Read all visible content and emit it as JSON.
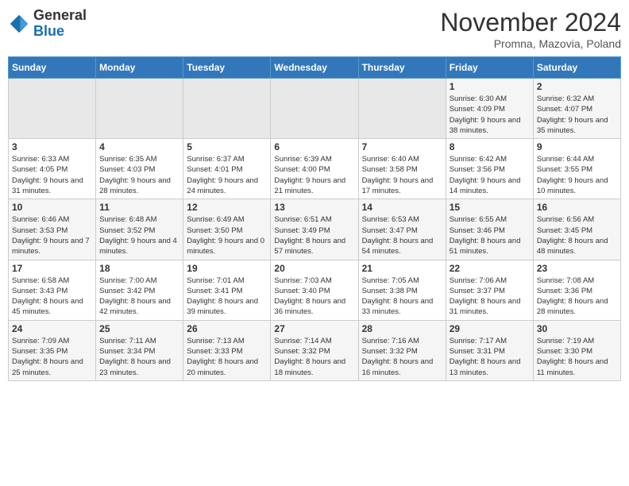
{
  "header": {
    "logo": {
      "general": "General",
      "blue": "Blue"
    },
    "title": "November 2024",
    "location": "Promna, Mazovia, Poland"
  },
  "weekdays": [
    "Sunday",
    "Monday",
    "Tuesday",
    "Wednesday",
    "Thursday",
    "Friday",
    "Saturday"
  ],
  "weeks": [
    [
      {
        "day": "",
        "info": ""
      },
      {
        "day": "",
        "info": ""
      },
      {
        "day": "",
        "info": ""
      },
      {
        "day": "",
        "info": ""
      },
      {
        "day": "",
        "info": ""
      },
      {
        "day": "1",
        "info": "Sunrise: 6:30 AM\nSunset: 4:09 PM\nDaylight: 9 hours and 38 minutes."
      },
      {
        "day": "2",
        "info": "Sunrise: 6:32 AM\nSunset: 4:07 PM\nDaylight: 9 hours and 35 minutes."
      }
    ],
    [
      {
        "day": "3",
        "info": "Sunrise: 6:33 AM\nSunset: 4:05 PM\nDaylight: 9 hours and 31 minutes."
      },
      {
        "day": "4",
        "info": "Sunrise: 6:35 AM\nSunset: 4:03 PM\nDaylight: 9 hours and 28 minutes."
      },
      {
        "day": "5",
        "info": "Sunrise: 6:37 AM\nSunset: 4:01 PM\nDaylight: 9 hours and 24 minutes."
      },
      {
        "day": "6",
        "info": "Sunrise: 6:39 AM\nSunset: 4:00 PM\nDaylight: 9 hours and 21 minutes."
      },
      {
        "day": "7",
        "info": "Sunrise: 6:40 AM\nSunset: 3:58 PM\nDaylight: 9 hours and 17 minutes."
      },
      {
        "day": "8",
        "info": "Sunrise: 6:42 AM\nSunset: 3:56 PM\nDaylight: 9 hours and 14 minutes."
      },
      {
        "day": "9",
        "info": "Sunrise: 6:44 AM\nSunset: 3:55 PM\nDaylight: 9 hours and 10 minutes."
      }
    ],
    [
      {
        "day": "10",
        "info": "Sunrise: 6:46 AM\nSunset: 3:53 PM\nDaylight: 9 hours and 7 minutes."
      },
      {
        "day": "11",
        "info": "Sunrise: 6:48 AM\nSunset: 3:52 PM\nDaylight: 9 hours and 4 minutes."
      },
      {
        "day": "12",
        "info": "Sunrise: 6:49 AM\nSunset: 3:50 PM\nDaylight: 9 hours and 0 minutes."
      },
      {
        "day": "13",
        "info": "Sunrise: 6:51 AM\nSunset: 3:49 PM\nDaylight: 8 hours and 57 minutes."
      },
      {
        "day": "14",
        "info": "Sunrise: 6:53 AM\nSunset: 3:47 PM\nDaylight: 8 hours and 54 minutes."
      },
      {
        "day": "15",
        "info": "Sunrise: 6:55 AM\nSunset: 3:46 PM\nDaylight: 8 hours and 51 minutes."
      },
      {
        "day": "16",
        "info": "Sunrise: 6:56 AM\nSunset: 3:45 PM\nDaylight: 8 hours and 48 minutes."
      }
    ],
    [
      {
        "day": "17",
        "info": "Sunrise: 6:58 AM\nSunset: 3:43 PM\nDaylight: 8 hours and 45 minutes."
      },
      {
        "day": "18",
        "info": "Sunrise: 7:00 AM\nSunset: 3:42 PM\nDaylight: 8 hours and 42 minutes."
      },
      {
        "day": "19",
        "info": "Sunrise: 7:01 AM\nSunset: 3:41 PM\nDaylight: 8 hours and 39 minutes."
      },
      {
        "day": "20",
        "info": "Sunrise: 7:03 AM\nSunset: 3:40 PM\nDaylight: 8 hours and 36 minutes."
      },
      {
        "day": "21",
        "info": "Sunrise: 7:05 AM\nSunset: 3:38 PM\nDaylight: 8 hours and 33 minutes."
      },
      {
        "day": "22",
        "info": "Sunrise: 7:06 AM\nSunset: 3:37 PM\nDaylight: 8 hours and 31 minutes."
      },
      {
        "day": "23",
        "info": "Sunrise: 7:08 AM\nSunset: 3:36 PM\nDaylight: 8 hours and 28 minutes."
      }
    ],
    [
      {
        "day": "24",
        "info": "Sunrise: 7:09 AM\nSunset: 3:35 PM\nDaylight: 8 hours and 25 minutes."
      },
      {
        "day": "25",
        "info": "Sunrise: 7:11 AM\nSunset: 3:34 PM\nDaylight: 8 hours and 23 minutes."
      },
      {
        "day": "26",
        "info": "Sunrise: 7:13 AM\nSunset: 3:33 PM\nDaylight: 8 hours and 20 minutes."
      },
      {
        "day": "27",
        "info": "Sunrise: 7:14 AM\nSunset: 3:32 PM\nDaylight: 8 hours and 18 minutes."
      },
      {
        "day": "28",
        "info": "Sunrise: 7:16 AM\nSunset: 3:32 PM\nDaylight: 8 hours and 16 minutes."
      },
      {
        "day": "29",
        "info": "Sunrise: 7:17 AM\nSunset: 3:31 PM\nDaylight: 8 hours and 13 minutes."
      },
      {
        "day": "30",
        "info": "Sunrise: 7:19 AM\nSunset: 3:30 PM\nDaylight: 8 hours and 11 minutes."
      }
    ]
  ]
}
